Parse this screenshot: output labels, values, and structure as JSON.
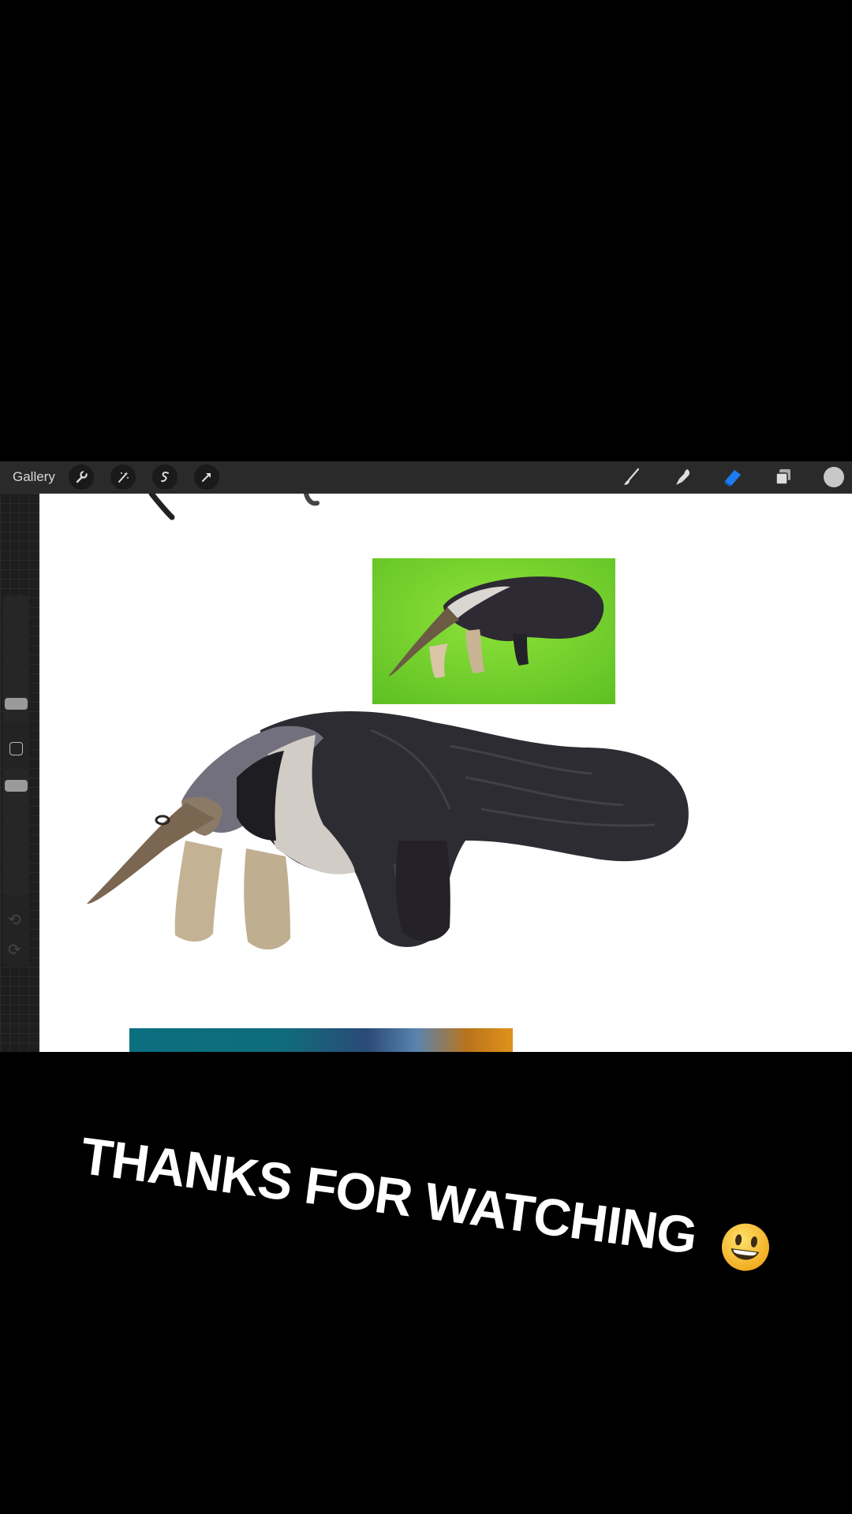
{
  "toolbar": {
    "gallery_label": "Gallery",
    "left_tools": [
      "wrench-icon",
      "magic-wand-icon",
      "selection-icon",
      "transform-arrow-icon"
    ],
    "right_tools": [
      "brush-icon",
      "smudge-icon",
      "eraser-icon",
      "layers-icon",
      "color-swatch"
    ],
    "active_tool": "eraser-icon",
    "active_color": "#1e7cf2",
    "current_color": "#c8c8c8"
  },
  "canvas": {
    "background": "#ffffff"
  },
  "caption": {
    "text": "THANKS FOR WATCHING",
    "emoji": "smiley-face-icon"
  }
}
